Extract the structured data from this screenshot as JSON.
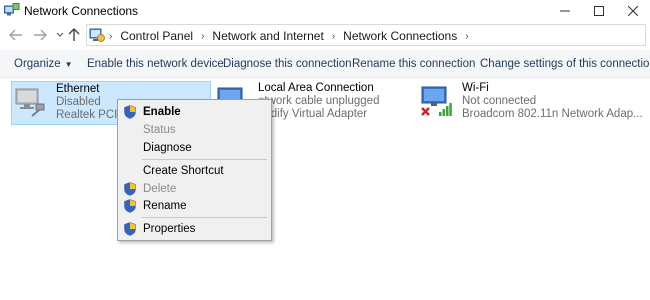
{
  "window": {
    "title": "Network Connections"
  },
  "address": {
    "crumbs": [
      "Control Panel",
      "Network and Internet",
      "Network Connections"
    ]
  },
  "commands": {
    "organize": "Organize",
    "enable": "Enable this network device",
    "diagnose": "Diagnose this connection",
    "rename": "Rename this connection",
    "change_settings": "Change settings of this connection"
  },
  "items": [
    {
      "name": "Ethernet",
      "status": "Disabled",
      "adapter": "Realtek PCIe F"
    },
    {
      "name": "Local Area Connection",
      "status": "etwork cable unplugged",
      "adapter": "eedify Virtual Adapter"
    },
    {
      "name": "Wi-Fi",
      "status": "Not connected",
      "adapter": "Broadcom 802.11n Network Adap..."
    }
  ],
  "context_menu": {
    "enable": "Enable",
    "status": "Status",
    "diagnose": "Diagnose",
    "create_shortcut": "Create Shortcut",
    "delete": "Delete",
    "rename": "Rename",
    "properties": "Properties"
  },
  "colors": {
    "selection_bg": "#cce8ff",
    "selection_border": "#99d1ff",
    "command_text": "#1e3a5f",
    "wifi_signal": "#3aa53a",
    "disconnected_x": "#d21f1f"
  }
}
